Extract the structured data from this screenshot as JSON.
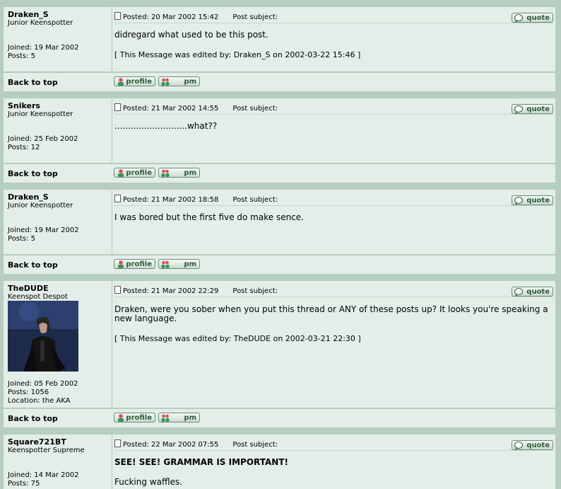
{
  "labels": {
    "posted_prefix": "Posted: ",
    "post_subject": "Post subject:",
    "quote": "quote",
    "profile": "profile",
    "pm": "pm",
    "back_to_top": "Back to top"
  },
  "posts": [
    {
      "username": "Draken_S",
      "rank": "Junior Keenspotter",
      "joined": "Joined: 19 Mar 2002",
      "posts": "Posts: 5",
      "location": "",
      "posted": "20 Mar 2002 15:42",
      "body": "didregard what used to be this post.",
      "edit": "[ This Message was edited by: Draken_S on 2002-03-22 15:46 ]"
    },
    {
      "username": "Snikers",
      "rank": "Junior Keenspotter",
      "joined": "Joined: 25 Feb 2002",
      "posts": "Posts: 12",
      "location": "",
      "posted": "21 Mar 2002 14:55",
      "body": "...........................what??",
      "edit": ""
    },
    {
      "username": "Draken_S",
      "rank": "Junior Keenspotter",
      "joined": "Joined: 19 Mar 2002",
      "posts": "Posts: 5",
      "location": "",
      "posted": "21 Mar 2002 18:58",
      "body": "I was bored but the first five do make sence.",
      "edit": ""
    },
    {
      "username": "TheDUDE",
      "rank": "Keenspot Despot",
      "joined": "Joined: 05 Feb 2002",
      "posts": "Posts: 1056",
      "location": "Location: the AKA",
      "posted": "21 Mar 2002 22:29",
      "body": "Draken, were you sober when you put this thread or ANY of these posts up? It looks you're speaking a new language.",
      "edit": "[ This Message was edited by: TheDUDE on 2002-03-21 22:30 ]"
    },
    {
      "username": "Square721BT",
      "rank": "Keenspotter Supreme",
      "joined": "Joined: 14 Mar 2002",
      "posts": "Posts: 75",
      "location": "",
      "posted": "22 Mar 2002 07:55",
      "body_bold": "SEE! SEE! GRAMMAR IS IMPORTANT!",
      "body": "Fucking waffles.",
      "edit": ""
    }
  ],
  "colors": {
    "panel": "#e3eee8",
    "border": "#b7cdbf",
    "button_text": "#2f5a3b"
  }
}
